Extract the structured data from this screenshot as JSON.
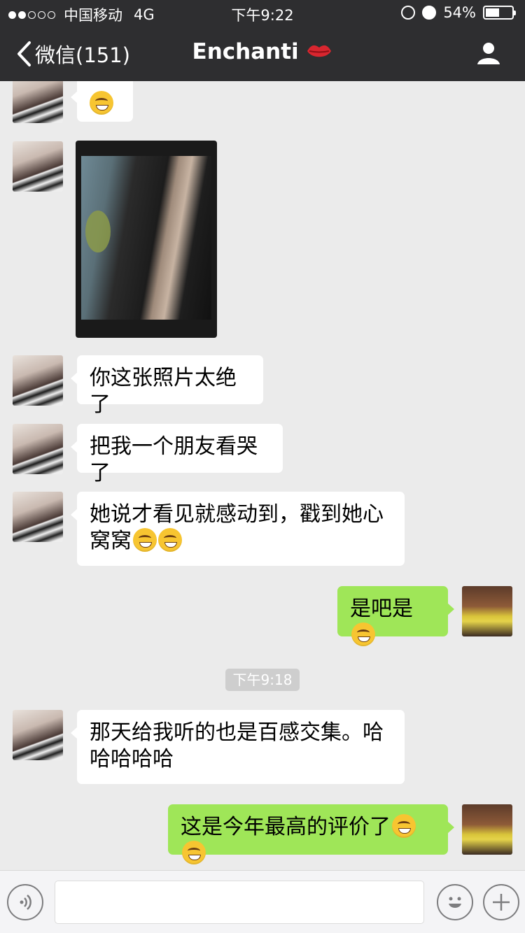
{
  "status_bar": {
    "carrier": "中国移动",
    "network": "4G",
    "time": "下午9:22",
    "battery_percent": "54%",
    "battery_level": 0.54
  },
  "nav": {
    "back_label": "微信(151)",
    "title": "Enchanti",
    "title_icon": "lips-icon",
    "right_icon": "person-icon"
  },
  "messages": {
    "m1_text": "你这张照片太绝了",
    "m2_text": "把我一个朋友看哭了",
    "m3_text": "她说才看见就感动到，戳到她心窝窝",
    "m4_text": "是吧是",
    "timestamp": "下午9:18",
    "m5_text": "那天给我听的也是百感交集。哈哈哈哈哈",
    "m6_text": "这是今年最高的评价了"
  },
  "input_bar": {
    "text": "",
    "voice_icon": "voice-icon",
    "emoji_icon": "emoji-icon",
    "plus_icon": "plus-icon"
  },
  "colors": {
    "nav_bg": "#2e2e30",
    "chat_bg": "#ebebeb",
    "outgoing_bubble": "#9fe658",
    "incoming_bubble": "#ffffff",
    "lips_red": "#d8262f"
  }
}
